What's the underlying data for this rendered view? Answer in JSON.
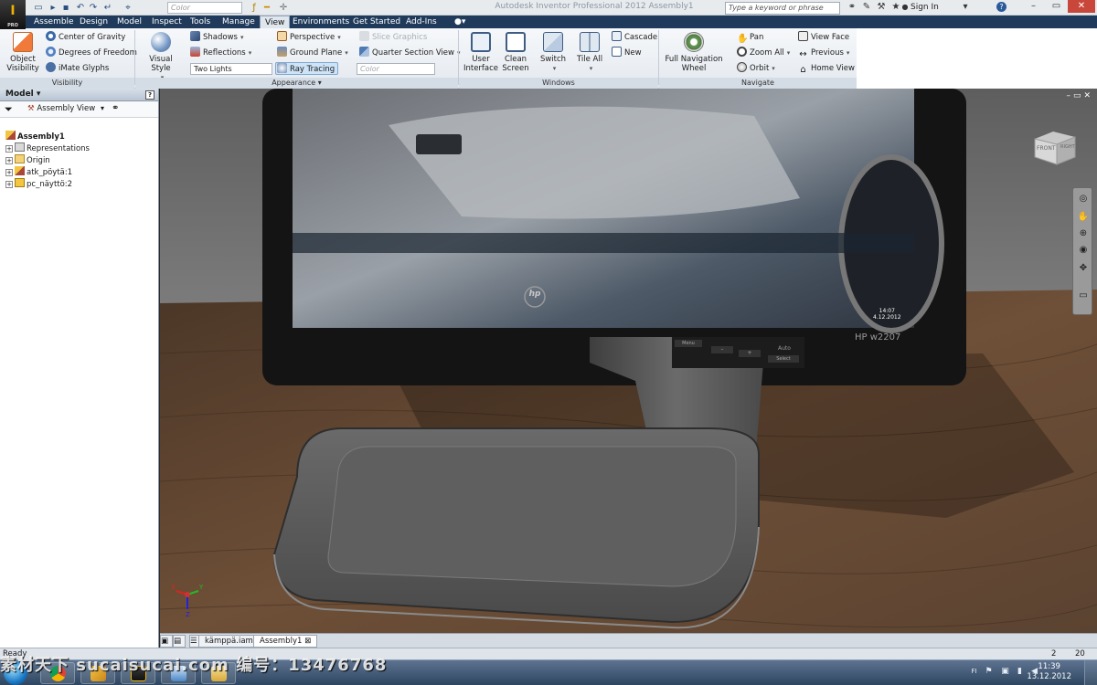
{
  "app": {
    "logo_text": "I",
    "logo_sub": "PRO",
    "window_title": "Autodesk Inventor Professional 2012   Assembly1",
    "qat_color_placeholder": "Color",
    "search_placeholder": "Type a keyword or phrase",
    "signin_label": "Sign In"
  },
  "tabs": [
    {
      "label": "Assemble"
    },
    {
      "label": "Design"
    },
    {
      "label": "Model"
    },
    {
      "label": "Inspect"
    },
    {
      "label": "Tools"
    },
    {
      "label": "Manage"
    },
    {
      "label": "View",
      "active": true
    },
    {
      "label": "Environments"
    },
    {
      "label": "Get Started"
    },
    {
      "label": "Add-Ins"
    }
  ],
  "ribbon": {
    "visibility": {
      "panel_label": "Visibility",
      "object_visibility": "Object Visibility",
      "object_visibility_line1": "Object",
      "object_visibility_line2": "Visibility",
      "center_of_gravity": "Center of Gravity",
      "degrees_of_freedom": "Degrees of Freedom",
      "imate_glyphs": "iMate Glyphs"
    },
    "appearance": {
      "panel_label": "Appearance",
      "visual_style": "Visual Style",
      "shadows": "Shadows",
      "reflections": "Reflections",
      "lighting_style": "Two Lights",
      "perspective": "Perspective",
      "ground_plane": "Ground Plane",
      "ray_tracing": "Ray Tracing",
      "slice_graphics": "Slice Graphics",
      "quarter_section_view": "Quarter Section View",
      "color_placeholder": "Color"
    },
    "windows": {
      "panel_label": "Windows",
      "user_interface_line1": "User",
      "user_interface_line2": "Interface",
      "clean_screen_line1": "Clean",
      "clean_screen_line2": "Screen",
      "switch": "Switch",
      "tile_all": "Tile All",
      "cascade": "Cascade",
      "new": "New"
    },
    "navigate": {
      "panel_label": "Navigate",
      "full_nav_wheel_line1": "Full Navigation",
      "full_nav_wheel_line2": "Wheel",
      "pan": "Pan",
      "zoom_all": "Zoom All",
      "orbit": "Orbit",
      "view_face": "View Face",
      "previous": "Previous",
      "home_view": "Home View"
    }
  },
  "browser": {
    "title": "Model",
    "view_label": "Assembly View",
    "tree": [
      {
        "label": "Assembly1",
        "bold": true
      },
      {
        "label": "Representations"
      },
      {
        "label": "Origin"
      },
      {
        "label": "atk_pöytä:1"
      },
      {
        "label": "pc_näyttö:2"
      }
    ]
  },
  "viewport": {
    "viewcube_front": "FRONT",
    "viewcube_right": "RIGHT",
    "monitor_brand": "hp",
    "monitor_model": "HP w2207",
    "monitor_buttons": [
      "Menu",
      "–",
      "+",
      "Select"
    ],
    "monitor_auto": "Auto",
    "screen_clock": "14:07",
    "screen_date": "4.12.2012",
    "axis_x": "X",
    "axis_y": "Y",
    "axis_z": "Z"
  },
  "doc_tabs": [
    {
      "label": "kämppä.iam"
    },
    {
      "label": "Assembly1",
      "active": true
    }
  ],
  "status": {
    "text": "Ready",
    "count_a": "2",
    "count_b": "20"
  },
  "taskbar": {
    "time": "11:39",
    "date": "13.12.2012",
    "tray_lang": "FI"
  },
  "watermark": "素材天下 sucaisucai.com   编号：13476768",
  "colors": {
    "tab_bar": "#1f3a5a",
    "ribbon_bg": "#eef2f6",
    "viewport_wall": "#6f6f6f",
    "desk_wood": "#5a4130",
    "monitor_bezel": "#141414",
    "stand_gray": "#5e5e5e"
  }
}
